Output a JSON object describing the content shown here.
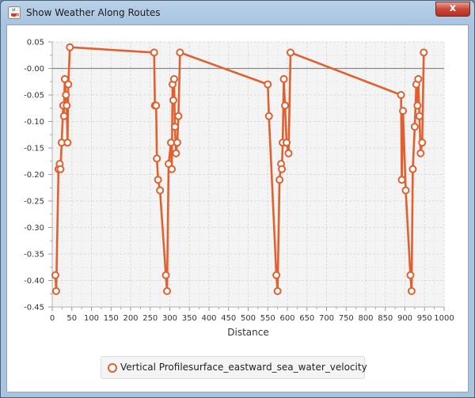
{
  "window": {
    "title": "Show Weather Along Routes",
    "close_label": "x"
  },
  "colors": {
    "series": "#e06030",
    "plot_bg": "#f4f4f4",
    "grid": "#dcdcdc"
  },
  "chart_data": {
    "type": "line",
    "title": "",
    "xlabel": "Distance",
    "ylabel": "",
    "xlim": [
      0,
      1000
    ],
    "ylim": [
      -0.45,
      0.05
    ],
    "xticks": [
      0,
      50,
      100,
      150,
      200,
      250,
      300,
      350,
      400,
      450,
      500,
      550,
      600,
      650,
      700,
      750,
      800,
      850,
      900,
      950,
      1000
    ],
    "yticks": [
      0.05,
      0.0,
      -0.05,
      -0.1,
      -0.15,
      -0.2,
      -0.25,
      -0.3,
      -0.35,
      -0.4,
      -0.45
    ],
    "ytick_labels": [
      "0.05",
      "-0.00",
      "-0.05",
      "-0.10",
      "-0.15",
      "-0.20",
      "-0.25",
      "-0.30",
      "-0.35",
      "-0.40",
      "-0.45"
    ],
    "grid": true,
    "legend": "bottom",
    "series": [
      {
        "name": "Vertical Profilesurface_eastward_sea_water_velocity",
        "x": [
          8,
          10,
          16,
          19,
          21,
          24,
          28,
          30,
          32,
          35,
          37,
          39,
          41,
          45,
          260,
          262,
          265,
          267,
          270,
          275,
          290,
          293,
          297,
          303,
          305,
          307,
          309,
          311,
          313,
          316,
          319,
          322,
          326,
          550,
          553,
          572,
          575,
          580,
          584,
          586,
          588,
          591,
          594,
          598,
          603,
          608,
          890,
          892,
          895,
          902,
          914,
          917,
          920,
          925,
          929,
          932,
          934,
          937,
          940,
          944,
          948
        ],
        "y": [
          -0.39,
          -0.42,
          -0.19,
          -0.18,
          -0.19,
          -0.14,
          -0.07,
          -0.09,
          -0.02,
          -0.05,
          -0.07,
          -0.14,
          -0.03,
          0.04,
          0.03,
          -0.07,
          -0.07,
          -0.17,
          -0.21,
          -0.23,
          -0.39,
          -0.42,
          -0.18,
          -0.14,
          -0.19,
          -0.03,
          -0.06,
          -0.02,
          -0.11,
          -0.16,
          -0.14,
          -0.09,
          0.03,
          -0.03,
          -0.09,
          -0.39,
          -0.42,
          -0.21,
          -0.18,
          -0.19,
          -0.14,
          -0.02,
          -0.07,
          -0.14,
          -0.16,
          0.03,
          -0.05,
          -0.21,
          -0.08,
          -0.23,
          -0.39,
          -0.42,
          -0.19,
          -0.11,
          -0.03,
          -0.07,
          -0.02,
          -0.09,
          -0.16,
          -0.14,
          0.03
        ]
      }
    ]
  }
}
